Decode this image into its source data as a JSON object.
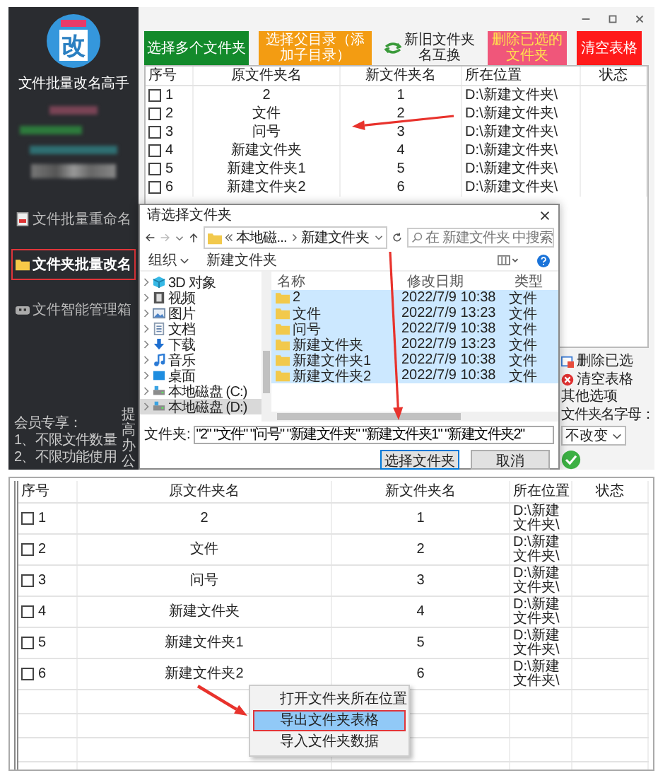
{
  "app": {
    "logo_char": "改",
    "title": "文件批量改名高手"
  },
  "sidebar": {
    "nav": [
      {
        "label": "文件批量重命名",
        "kind": "file",
        "selected": false
      },
      {
        "label": "文件夹批量改名",
        "kind": "folder",
        "selected": true
      },
      {
        "label": "文件智能管理箱",
        "kind": "box",
        "selected": false
      }
    ],
    "member_note": [
      "会员专享：",
      "1、不限文件数量",
      "2、不限功能使用"
    ],
    "vertical_note": "提高办公"
  },
  "toolbar": [
    {
      "label": "选择多个文件夹",
      "kind": "green"
    },
    {
      "label": "选择父目录（添加子目录）",
      "kind": "orange"
    },
    {
      "label": "新旧文件夹名互换",
      "kind": "swap"
    },
    {
      "label": "删除已选的文件夹",
      "kind": "pink"
    },
    {
      "label": "清空表格",
      "kind": "red"
    }
  ],
  "table": {
    "columns": [
      "序号",
      "原文件夹名",
      "新文件夹名",
      "所在位置",
      "状态"
    ],
    "rows": [
      {
        "index": "1",
        "checked": false,
        "original": "2",
        "new": "1",
        "location": "D:\\新建文件夹\\"
      },
      {
        "index": "2",
        "checked": false,
        "original": "文件",
        "new": "2",
        "location": "D:\\新建文件夹\\"
      },
      {
        "index": "3",
        "checked": false,
        "original": "问号",
        "new": "3",
        "location": "D:\\新建文件夹\\"
      },
      {
        "index": "4",
        "checked": false,
        "original": "新建文件夹",
        "new": "4",
        "location": "D:\\新建文件夹\\"
      },
      {
        "index": "5",
        "checked": false,
        "original": "新建文件夹1",
        "new": "5",
        "location": "D:\\新建文件夹\\"
      },
      {
        "index": "6",
        "checked": false,
        "original": "新建文件夹2",
        "new": "6",
        "location": "D:\\新建文件夹\\"
      }
    ]
  },
  "side_panel": {
    "actions": [
      {
        "label": "删除已选",
        "kind": "delete"
      },
      {
        "label": "清空表格",
        "kind": "clear"
      }
    ],
    "options_title": "其他选项",
    "letter_case_label": "文件夹名字母：",
    "letter_case_value": "不改变"
  },
  "dialog": {
    "title": "请选择文件夹",
    "path": [
      "本地磁...",
      "新建文件夹"
    ],
    "search_placeholder": "在 新建文件夹 中搜索",
    "toolbar": [
      "组织",
      "新建文件夹"
    ],
    "nav": [
      {
        "label": "3D 对象",
        "kind": "objects",
        "selected": false
      },
      {
        "label": "视频",
        "kind": "video",
        "selected": false
      },
      {
        "label": "图片",
        "kind": "pictures",
        "selected": false
      },
      {
        "label": "文档",
        "kind": "documents",
        "selected": false
      },
      {
        "label": "下载",
        "kind": "downloads",
        "selected": false
      },
      {
        "label": "音乐",
        "kind": "music",
        "selected": false
      },
      {
        "label": "桌面",
        "kind": "desktop",
        "selected": false
      },
      {
        "label": "本地磁盘 (C:)",
        "kind": "drive",
        "selected": false
      },
      {
        "label": "本地磁盘 (D:)",
        "kind": "drive",
        "selected": true
      }
    ],
    "columns": [
      "名称",
      "修改日期",
      "类型"
    ],
    "files": [
      {
        "name": "2",
        "date": "2022/7/9 10:38",
        "type": "文件",
        "selected": true
      },
      {
        "name": "文件",
        "date": "2022/7/9 13:23",
        "type": "文件",
        "selected": true
      },
      {
        "name": "问号",
        "date": "2022/7/9 10:38",
        "type": "文件",
        "selected": true
      },
      {
        "name": "新建文件夹",
        "date": "2022/7/9 13:23",
        "type": "文件",
        "selected": true
      },
      {
        "name": "新建文件夹1",
        "date": "2022/7/9 10:38",
        "type": "文件",
        "selected": true
      },
      {
        "name": "新建文件夹2",
        "date": "2022/7/9 10:38",
        "type": "文件",
        "selected": true
      }
    ],
    "filename_label": "文件夹:",
    "filename_value": "\"2\" \"文件\" \"问号\" \"新建文件夹\" \"新建文件夹1\" \"新建文件夹2\"",
    "buttons": [
      {
        "label": "选择文件夹",
        "kind": "primary"
      },
      {
        "label": "取消",
        "kind": "normal"
      }
    ]
  },
  "bottom": {
    "table": {
      "columns": [
        "序号",
        "原文件夹名",
        "新文件夹名",
        "所在位置",
        "状态"
      ],
      "rows": [
        {
          "index": "1",
          "checked": false,
          "original": "2",
          "new": "1",
          "location": "D:\\新建文件夹\\"
        },
        {
          "index": "2",
          "checked": false,
          "original": "文件",
          "new": "2",
          "location": "D:\\新建文件夹\\"
        },
        {
          "index": "3",
          "checked": false,
          "original": "问号",
          "new": "3",
          "location": "D:\\新建文件夹\\"
        },
        {
          "index": "4",
          "checked": false,
          "original": "新建文件夹",
          "new": "4",
          "location": "D:\\新建文件夹\\"
        },
        {
          "index": "5",
          "checked": false,
          "original": "新建文件夹1",
          "new": "5",
          "location": "D:\\新建文件夹\\"
        },
        {
          "index": "6",
          "checked": false,
          "original": "新建文件夹2",
          "new": "6",
          "location": "D:\\新建文件夹\\"
        }
      ]
    },
    "context_menu": [
      {
        "label": "打开文件夹所在位置",
        "selected": false
      },
      {
        "label": "导出文件夹表格",
        "selected": true
      },
      {
        "label": "导入文件夹数据",
        "selected": false
      }
    ]
  }
}
